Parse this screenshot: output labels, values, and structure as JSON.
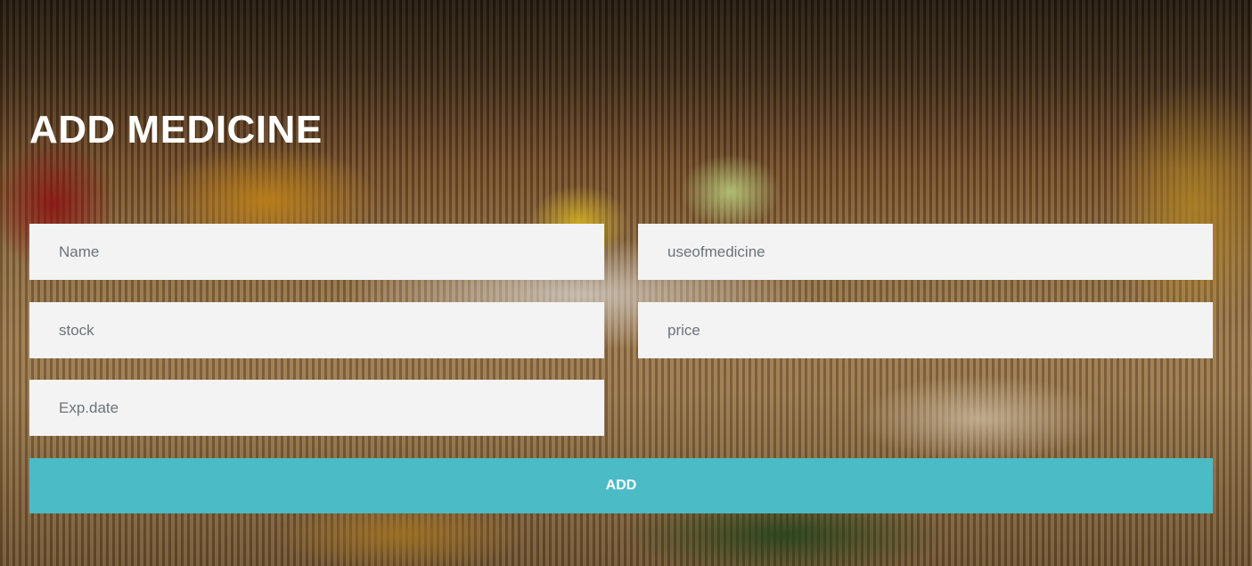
{
  "page": {
    "title": "ADD MEDICINE"
  },
  "form": {
    "name_placeholder": "Name",
    "use_placeholder": "useofmedicine",
    "stock_placeholder": "stock",
    "price_placeholder": "price",
    "expdate_placeholder": "Exp.date",
    "submit_label": "ADD"
  },
  "colors": {
    "button": "#4bbbc6",
    "field_background": "#f3f3f3",
    "title_text": "#ffffff"
  }
}
